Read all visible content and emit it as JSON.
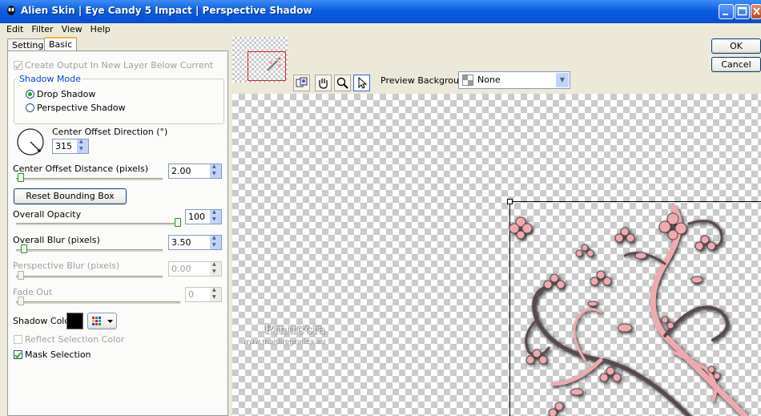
{
  "window": {
    "title": "Alien Skin  |  Eye Candy 5 Impact  |  Perspective Shadow"
  },
  "menu": [
    "Edit",
    "Filter",
    "View",
    "Help"
  ],
  "tabs": {
    "settings": "Settings",
    "basic": "Basic"
  },
  "options": {
    "create_output": "Create Output In New Layer Below Current",
    "shadow_mode_title": "Shadow Mode",
    "drop_shadow": "Drop Shadow",
    "perspective_shadow": "Perspective Shadow",
    "center_offset_direction": "Center Offset Direction (°)",
    "direction_value": "315",
    "center_offset_distance": "Center Offset Distance (pixels)",
    "distance_value": "2.00",
    "reset_bounding_box": "Reset Bounding Box",
    "overall_opacity": "Overall Opacity",
    "opacity_value": "100",
    "overall_blur": "Overall Blur (pixels)",
    "blur_value": "3.50",
    "perspective_blur": "Perspective Blur (pixels)",
    "perspective_blur_value": "0.00",
    "fade_out": "Fade Out",
    "fade_out_value": "0",
    "shadow_color": "Shadow Color",
    "reflect_selection_color": "Reflect Selection Color",
    "mask_selection": "Mask Selection"
  },
  "buttons": {
    "ok": "OK",
    "cancel": "Cancel"
  },
  "preview": {
    "background_label": "Preview Background:",
    "background_value": "None",
    "watermark_name": "Pinuccia",
    "watermark_url": "www.maidiregrafica.eu"
  },
  "colors": {
    "accent_pink": "#f0a9ae",
    "stem_brown": "#5a4a4e",
    "shadow_color": "#000000"
  }
}
